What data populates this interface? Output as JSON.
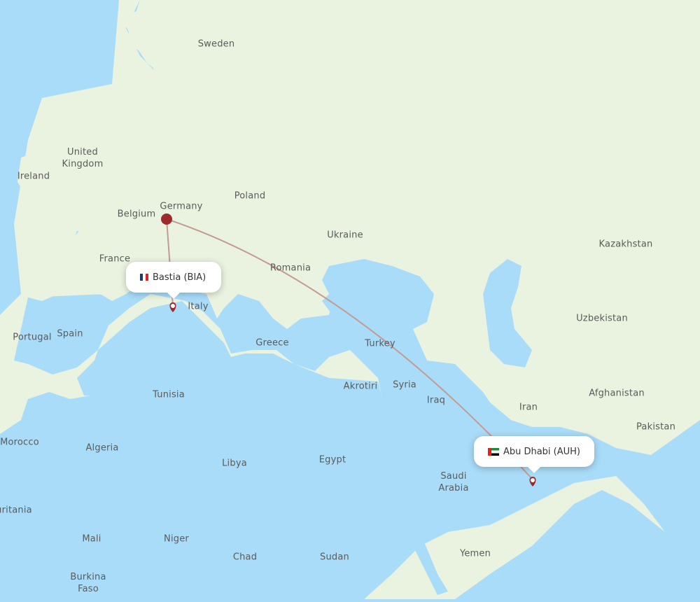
{
  "map": {
    "colors": {
      "sea": "#a9dcf8",
      "land": "#eaf3e0",
      "border": "#a8d49a",
      "route": "#c49a94",
      "marker": "#9e2b2b"
    },
    "origin": {
      "city": "Bastia",
      "code": "BIA",
      "label": "Bastia (BIA)",
      "flag": "france-flag"
    },
    "destination": {
      "city": "Abu Dhabi",
      "code": "AUH",
      "label": "Abu Dhabi (AUH)",
      "flag": "uae-flag"
    },
    "connection": {
      "label": "Germany hub"
    },
    "country_labels": [
      "Sweden",
      "United Kingdom",
      "Ireland",
      "Poland",
      "Belgium",
      "Germany",
      "Ukraine",
      "Kazakhstan",
      "France",
      "Romania",
      "Italy",
      "Uzbekistan",
      "Portugal",
      "Spain",
      "Greece",
      "Turkey",
      "Akrotiri",
      "Syria",
      "Tunisia",
      "Iraq",
      "Iran",
      "Afghanistan",
      "Pakistan",
      "Morocco",
      "Algeria",
      "Libya",
      "Egypt",
      "Saudi Arabia",
      "uritania",
      "Mali",
      "Niger",
      "Chad",
      "Sudan",
      "Yemen",
      "Burkina Faso"
    ]
  }
}
